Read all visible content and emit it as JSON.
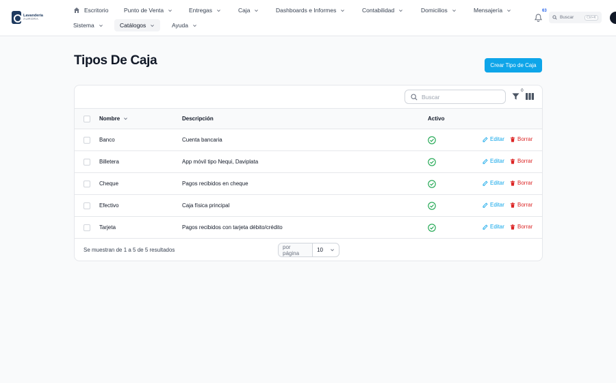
{
  "brand": {
    "line1": "Lavandería",
    "line2": "AURORA"
  },
  "nav": {
    "row1": [
      {
        "label": "Escritorio"
      },
      {
        "label": "Punto de Venta"
      },
      {
        "label": "Entregas"
      },
      {
        "label": "Caja"
      },
      {
        "label": "Dashboards e Informes"
      },
      {
        "label": "Contabilidad"
      },
      {
        "label": "Domicilios"
      },
      {
        "label": "Mensajería"
      }
    ],
    "row2": [
      {
        "label": "Sistema"
      },
      {
        "label": "Catálogos",
        "active": true
      },
      {
        "label": "Ayuda"
      }
    ]
  },
  "notifications": {
    "count": "63"
  },
  "global_search": {
    "placeholder": "Buscar",
    "shortcut": "Ctrl+K"
  },
  "page": {
    "title": "Tipos De Caja",
    "create_button": "Crear Tipo de Caja"
  },
  "table": {
    "search_placeholder": "Buscar",
    "filter_count": "0",
    "columns": {
      "name": "Nombre",
      "description": "Descripción",
      "active": "Activo"
    },
    "rows": [
      {
        "name": "Banco",
        "description": "Cuenta bancaria",
        "active": true
      },
      {
        "name": "Billetera",
        "description": "App móvil tipo Nequi, Daviplata",
        "active": true
      },
      {
        "name": "Cheque",
        "description": "Pagos recibidos en cheque",
        "active": true
      },
      {
        "name": "Efectivo",
        "description": "Caja física principal",
        "active": true
      },
      {
        "name": "Tarjeta",
        "description": "Pagos recibidos con tarjeta débito/crédito",
        "active": true
      }
    ],
    "actions": {
      "edit": "Editar",
      "delete": "Borrar"
    },
    "footer": {
      "summary": "Se muestran de 1 a 5 de 5 resultados",
      "per_page_label": "por página",
      "per_page_value": "10"
    }
  },
  "colors": {
    "primary": "#0ea5e9",
    "danger": "#dc2626",
    "success": "#16a34a"
  }
}
